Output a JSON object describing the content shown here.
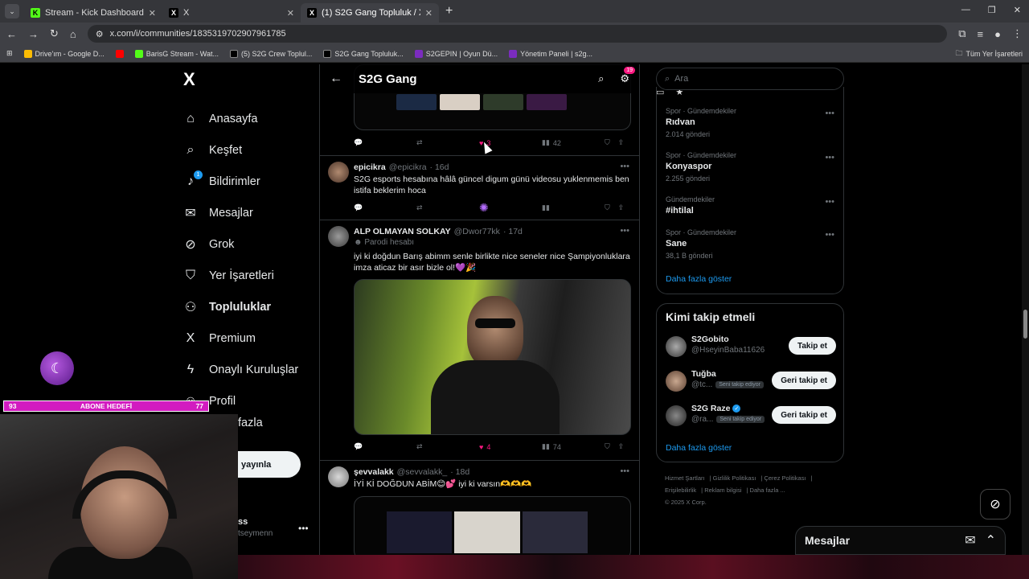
{
  "browser": {
    "tabs": [
      {
        "title": "Stream - Kick Dashboard",
        "fav": "K",
        "fav_color": "#53fc18"
      },
      {
        "title": "X",
        "fav": "X",
        "fav_color": "#000000"
      },
      {
        "title": "(1) S2G Gang Topluluk / X",
        "fav": "X",
        "fav_color": "#000000"
      }
    ],
    "url": "x.com/i/communities/1835319702907961785",
    "bookmarks": [
      {
        "label": "Drive'ım - Google D...",
        "color": "#fbbc04"
      },
      {
        "label": "",
        "color": "#ff0000"
      },
      {
        "label": "BarisG Stream - Wat...",
        "color": "#53fc18"
      },
      {
        "label": "(5) S2G Crew Toplul...",
        "color": "#000000"
      },
      {
        "label": "S2G Gang Topluluk...",
        "color": "#000000"
      },
      {
        "label": "S2GEPIN | Oyun Dü...",
        "color": "#7b2cbf"
      },
      {
        "label": "Yönetim Paneli | s2g...",
        "color": "#7b2cbf"
      }
    ],
    "bookmarks_right": "Tüm Yer İşaretleri"
  },
  "nav": {
    "items": [
      {
        "label": "Anasayfa",
        "icon": "home-icon",
        "glyph": "⌂"
      },
      {
        "label": "Keşfet",
        "icon": "search-icon",
        "glyph": "⌕"
      },
      {
        "label": "Bildirimler",
        "icon": "bell-icon",
        "glyph": "🔔",
        "badge": "1"
      },
      {
        "label": "Mesajlar",
        "icon": "mail-icon",
        "glyph": "✉"
      },
      {
        "label": "Grok",
        "icon": "grok-icon",
        "glyph": "⊘"
      },
      {
        "label": "Yer İşaretleri",
        "icon": "bookmark-icon",
        "glyph": "⛉"
      },
      {
        "label": "Topluluklar",
        "icon": "communities-icon",
        "glyph": "👥",
        "bold": true
      },
      {
        "label": "Premium",
        "icon": "x-icon",
        "glyph": "X"
      },
      {
        "label": "Onaylı Kuruluşlar",
        "icon": "lightning-icon",
        "glyph": "ϟ"
      },
      {
        "label": "Profil",
        "icon": "profile-icon",
        "glyph": "👤"
      }
    ],
    "more_label": "fazla",
    "post_label": "yayınla",
    "user_name": "ss",
    "user_handle": "tseymenn"
  },
  "main": {
    "title": "S2G Gang",
    "settings_badge": "19",
    "top_post_actions": {
      "likes": "3",
      "views": "42"
    },
    "tweets": [
      {
        "name": "epicikra",
        "handle": "@epicikra",
        "time": "· 16d",
        "text": "S2G esports hesabına hâlâ güncel digum günü videosu yuklenmemis ben istifa beklerim hoca",
        "likes": "",
        "views": ""
      },
      {
        "name": "ALP OLMAYAN SOLKAY",
        "handle": "@Dwor77kk",
        "time": "· 17d",
        "parody": "Parodi hesabı",
        "text": "iyi ki doğdun Barış abimm senle birlikte nice seneler nice Şampiyonluklara imza aticaz bir asır bizle ol!💜🎉",
        "likes": "4",
        "views": "74"
      },
      {
        "name": "şevvalakk",
        "handle": "@sevvalakk_",
        "time": "· 18d",
        "text": "İYİ Kİ DOĞDUN ABİM😊💕 iyi ki varsın🫶🫶🫶"
      }
    ]
  },
  "right": {
    "search_placeholder": "Ara",
    "trends": [
      {
        "category": "Spor · Gündemdekiler",
        "name": "Rıdvan",
        "count": "2.014 gönderi"
      },
      {
        "category": "Spor · Gündemdekiler",
        "name": "Konyaspor",
        "count": "2.255 gönderi"
      },
      {
        "category": "Gündemdekiler",
        "name": "#ihtilal",
        "count": ""
      },
      {
        "category": "Spor · Gündemdekiler",
        "name": "Sane",
        "count": "38,1 B gönderi"
      }
    ],
    "show_more": "Daha fazla göster",
    "who_to_follow_title": "Kimi takip etmeli",
    "follow": [
      {
        "name": "S2Gobito",
        "handle": "@HseyinBaba11626",
        "button": "Takip et",
        "tag": "",
        "verified": false
      },
      {
        "name": "Tuğba",
        "handle": "@tc...",
        "button": "Geri takip et",
        "tag": "Seni takip ediyor",
        "verified": false
      },
      {
        "name": "S2G Raze",
        "handle": "@ra...",
        "button": "Geri takip et",
        "tag": "Seni takip ediyor",
        "verified": true
      }
    ],
    "footer": [
      "Hizmet Şartları",
      "Gizlilik Politikası",
      "Çerez Politikası",
      "Erişilebilirlik",
      "Reklam bilgisi",
      "Daha fazla ...",
      "© 2025 X Corp."
    ],
    "messages_title": "Mesajlar"
  },
  "overlay": {
    "sub_goal_left": "93",
    "sub_goal_label": "ABONE HEDEFİ",
    "sub_goal_right": "77"
  }
}
